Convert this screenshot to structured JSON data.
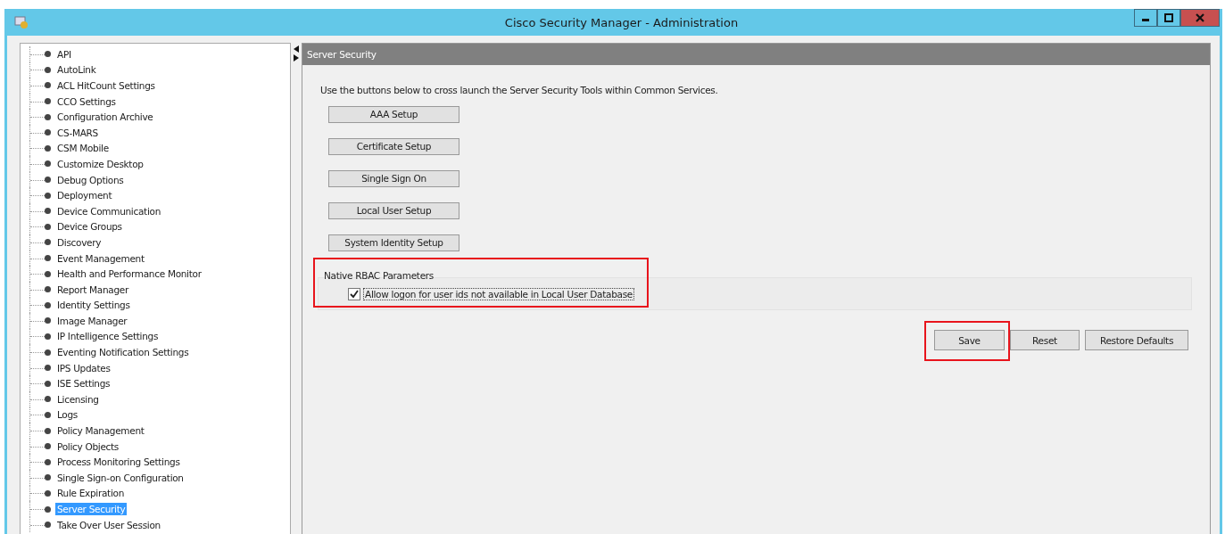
{
  "window": {
    "title": "Cisco Security Manager - Administration"
  },
  "tree": {
    "items": [
      {
        "label": "API",
        "selected": false
      },
      {
        "label": "AutoLink",
        "selected": false
      },
      {
        "label": "ACL HitCount Settings",
        "selected": false
      },
      {
        "label": "CCO Settings",
        "selected": false
      },
      {
        "label": "Configuration Archive",
        "selected": false
      },
      {
        "label": "CS-MARS",
        "selected": false
      },
      {
        "label": "CSM Mobile",
        "selected": false
      },
      {
        "label": "Customize Desktop",
        "selected": false
      },
      {
        "label": "Debug Options",
        "selected": false
      },
      {
        "label": "Deployment",
        "selected": false
      },
      {
        "label": "Device Communication",
        "selected": false
      },
      {
        "label": "Device Groups",
        "selected": false
      },
      {
        "label": "Discovery",
        "selected": false
      },
      {
        "label": "Event Management",
        "selected": false
      },
      {
        "label": "Health and Performance Monitor",
        "selected": false
      },
      {
        "label": "Report Manager",
        "selected": false
      },
      {
        "label": "Identity Settings",
        "selected": false
      },
      {
        "label": "Image Manager",
        "selected": false
      },
      {
        "label": "IP Intelligence Settings",
        "selected": false
      },
      {
        "label": "Eventing Notification Settings",
        "selected": false
      },
      {
        "label": "IPS Updates",
        "selected": false
      },
      {
        "label": "ISE Settings",
        "selected": false
      },
      {
        "label": "Licensing",
        "selected": false
      },
      {
        "label": "Logs",
        "selected": false
      },
      {
        "label": "Policy Management",
        "selected": false
      },
      {
        "label": "Policy Objects",
        "selected": false
      },
      {
        "label": "Process Monitoring Settings",
        "selected": false
      },
      {
        "label": "Single Sign-on Configuration",
        "selected": false
      },
      {
        "label": "Rule Expiration",
        "selected": false
      },
      {
        "label": "Server Security",
        "selected": true
      },
      {
        "label": "Take Over User Session",
        "selected": false
      }
    ]
  },
  "panel": {
    "title": "Server Security",
    "intro": "Use the buttons below to cross launch the Server Security Tools within Common Services.",
    "tool_buttons": [
      "AAA Setup",
      "Certificate Setup",
      "Single Sign On",
      "Local User Setup",
      "System Identity Setup"
    ],
    "rbac": {
      "title": "Native RBAC Parameters",
      "highlighted": true,
      "option": {
        "label": "Allow logon for user ids not available in Local User Database",
        "checked": true
      }
    },
    "actions": [
      {
        "label": "Save",
        "highlighted": true
      },
      {
        "label": "Reset",
        "highlighted": false
      },
      {
        "label": "Restore Defaults",
        "highlighted": false
      }
    ]
  }
}
